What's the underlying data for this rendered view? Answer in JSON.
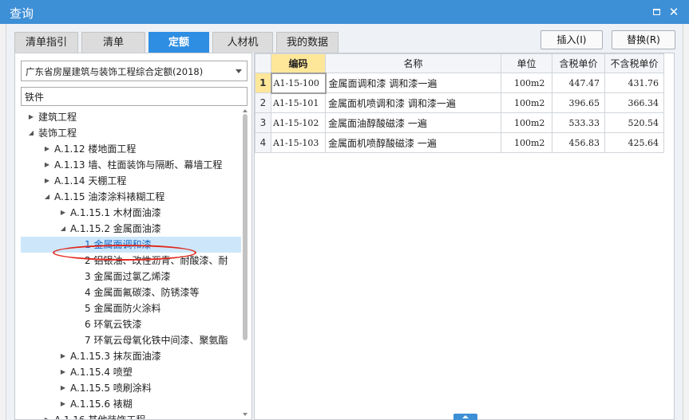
{
  "window": {
    "title": "查询"
  },
  "tabs": [
    {
      "label": "清单指引"
    },
    {
      "label": "清单"
    },
    {
      "label": "定额"
    },
    {
      "label": "人材机"
    },
    {
      "label": "我的数据"
    }
  ],
  "actions": {
    "insert_label": "插入(I)",
    "replace_label": "替换(R)"
  },
  "left": {
    "library_selected": "广东省房屋建筑与装饰工程综合定额(2018)",
    "search_value": "铁件",
    "tree": [
      {
        "label": "建筑工程",
        "level": 0,
        "toggle": "collapsed"
      },
      {
        "label": "装饰工程",
        "level": 0,
        "toggle": "expanded"
      },
      {
        "label": "A.1.12 楼地面工程",
        "level": 1,
        "toggle": "collapsed"
      },
      {
        "label": "A.1.13 墙、柱面装饰与隔断、幕墙工程",
        "level": 1,
        "toggle": "collapsed"
      },
      {
        "label": "A.1.14 天棚工程",
        "level": 1,
        "toggle": "collapsed"
      },
      {
        "label": "A.1.15 油漆涂料裱糊工程",
        "level": 1,
        "toggle": "expanded"
      },
      {
        "label": "A.1.15.1 木材面油漆",
        "level": 2,
        "toggle": "collapsed"
      },
      {
        "label": "A.1.15.2 金属面油漆",
        "level": 2,
        "toggle": "expanded"
      },
      {
        "label": "1 金属面调和漆",
        "level": 3,
        "toggle": "none",
        "selected": true
      },
      {
        "label": "2 铝银油、改性沥青、耐酸漆、耐",
        "level": 3,
        "toggle": "none"
      },
      {
        "label": "3 金属面过氯乙烯漆",
        "level": 3,
        "toggle": "none"
      },
      {
        "label": "4 金属面氟碳漆、防锈漆等",
        "level": 3,
        "toggle": "none"
      },
      {
        "label": "5 金属面防火涂料",
        "level": 3,
        "toggle": "none"
      },
      {
        "label": "6 环氧云铁漆",
        "level": 3,
        "toggle": "none"
      },
      {
        "label": "7 环氧云母氧化铁中间漆、聚氨酯",
        "level": 3,
        "toggle": "none"
      },
      {
        "label": "A.1.15.3 抹灰面油漆",
        "level": 2,
        "toggle": "collapsed"
      },
      {
        "label": "A.1.15.4 喷塑",
        "level": 2,
        "toggle": "collapsed"
      },
      {
        "label": "A.1.15.5 喷刷涂料",
        "level": 2,
        "toggle": "collapsed"
      },
      {
        "label": "A.1.15.6 裱糊",
        "level": 2,
        "toggle": "collapsed"
      },
      {
        "label": "A.1.16 其他装饰工程",
        "level": 1,
        "toggle": "collapsed"
      }
    ]
  },
  "grid": {
    "headers": [
      "",
      "编码",
      "名称",
      "单位",
      "含税单价",
      "不含税单价"
    ],
    "rows": [
      {
        "no": "1",
        "code": "A1-15-100",
        "name": "金属面调和漆 调和漆一遍",
        "unit": "100m2",
        "price_tax": "447.47",
        "price_notax": "431.76"
      },
      {
        "no": "2",
        "code": "A1-15-101",
        "name": "金属面机喷调和漆 调和漆一遍",
        "unit": "100m2",
        "price_tax": "396.65",
        "price_notax": "366.34"
      },
      {
        "no": "3",
        "code": "A1-15-102",
        "name": "金属面油醇酸磁漆 一遍",
        "unit": "100m2",
        "price_tax": "533.33",
        "price_notax": "520.54"
      },
      {
        "no": "4",
        "code": "A1-15-103",
        "name": "金属面机喷醇酸磁漆 一遍",
        "unit": "100m2",
        "price_tax": "456.83",
        "price_notax": "425.64"
      }
    ]
  }
}
